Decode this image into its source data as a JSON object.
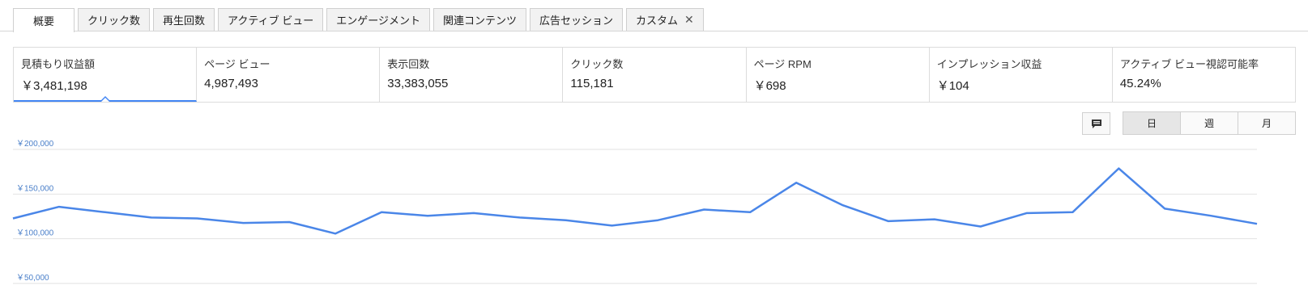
{
  "tabs": [
    {
      "label": "概要",
      "active": true
    },
    {
      "label": "クリック数"
    },
    {
      "label": "再生回数"
    },
    {
      "label": "アクティブ ビュー"
    },
    {
      "label": "エンゲージメント"
    },
    {
      "label": "関連コンテンツ"
    },
    {
      "label": "広告セッション"
    },
    {
      "label": "カスタム",
      "closable": true
    }
  ],
  "metrics": [
    {
      "label": "見積もり収益額",
      "value": "￥3,481,198",
      "selected": true
    },
    {
      "label": "ページ ビュー",
      "value": "4,987,493"
    },
    {
      "label": "表示回数",
      "value": "33,383,055"
    },
    {
      "label": "クリック数",
      "value": "115,181"
    },
    {
      "label": "ページ RPM",
      "value": "￥698"
    },
    {
      "label": "インプレッション収益",
      "value": "￥104"
    },
    {
      "label": "アクティブ ビュー視認可能率",
      "value": "45.24%"
    }
  ],
  "controls": {
    "annotation_icon": "comment-icon",
    "periods": [
      {
        "label": "日",
        "active": true
      },
      {
        "label": "週"
      },
      {
        "label": "月"
      }
    ]
  },
  "colors": {
    "line": "#4a86e8",
    "accent": "#4285f4"
  },
  "chart_data": {
    "type": "line",
    "ytick_labels": [
      "￥200,000",
      "￥150,000",
      "￥100,000",
      "￥50,000"
    ],
    "ytick_values": [
      200000,
      150000,
      100000,
      50000
    ],
    "ylim": [
      50000,
      200000
    ],
    "grid": true,
    "series": [
      {
        "values": [
          120000,
          133000,
          127000,
          121000,
          120000,
          115000,
          116000,
          103000,
          127000,
          123000,
          126000,
          121000,
          118000,
          112000,
          118000,
          130000,
          127000,
          160000,
          135000,
          117000,
          119000,
          111000,
          126000,
          127000,
          176000,
          131000,
          123000,
          114000
        ]
      }
    ]
  }
}
